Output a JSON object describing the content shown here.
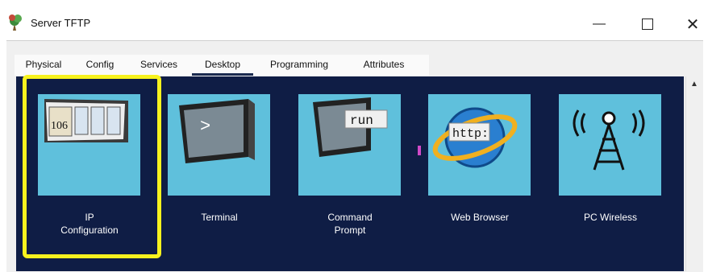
{
  "window": {
    "title": "Server TFTP",
    "icon": "server-tree-icon",
    "controls": {
      "minimize": "—",
      "maximize_icon": "maximize-icon",
      "close": "✕"
    }
  },
  "tabs": [
    {
      "label": "Physical"
    },
    {
      "label": "Config"
    },
    {
      "label": "Services"
    },
    {
      "label": "Desktop",
      "active": true
    },
    {
      "label": "Programming"
    },
    {
      "label": "Attributes"
    }
  ],
  "desktop": {
    "apps": [
      {
        "line1": "IP",
        "line2": "Configuration",
        "icon": "ip-configuration-icon",
        "icon_text": "106",
        "highlighted": true
      },
      {
        "line1": "Terminal",
        "line2": "",
        "icon": "terminal-icon",
        "icon_text": ">"
      },
      {
        "line1": "Command",
        "line2": "Prompt",
        "icon": "command-prompt-icon",
        "icon_text": "run"
      },
      {
        "line1": "Web Browser",
        "line2": "",
        "icon": "web-browser-icon",
        "icon_text": "http:"
      },
      {
        "line1": "PC Wireless",
        "line2": "",
        "icon": "pc-wireless-icon",
        "icon_text": ""
      }
    ]
  },
  "colors": {
    "panel_bg": "#0f1d45",
    "tile_bg": "#5fc0dc",
    "highlight": "#f7f21e",
    "active_tab_underline": "#1a2a4f"
  }
}
